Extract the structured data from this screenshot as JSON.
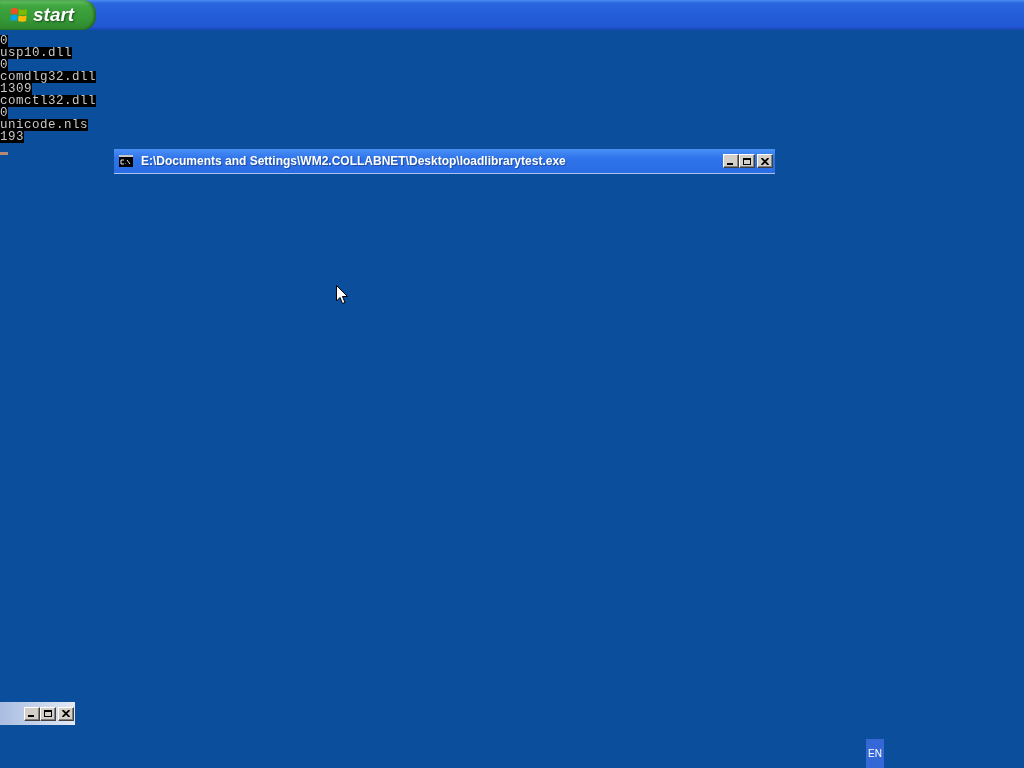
{
  "taskbar": {
    "start_label": "start"
  },
  "console_output": {
    "lines": [
      "0",
      "usp10.dll",
      "0",
      "comdlg32.dll",
      "1309",
      "comctl32.dll",
      "0",
      "unicode.nls",
      "193"
    ]
  },
  "console_window": {
    "title": "E:\\Documents and Settings\\WM2.COLLABNET\\Desktop\\loadlibrarytest.exe"
  },
  "language_indicator": {
    "label": "EN"
  }
}
